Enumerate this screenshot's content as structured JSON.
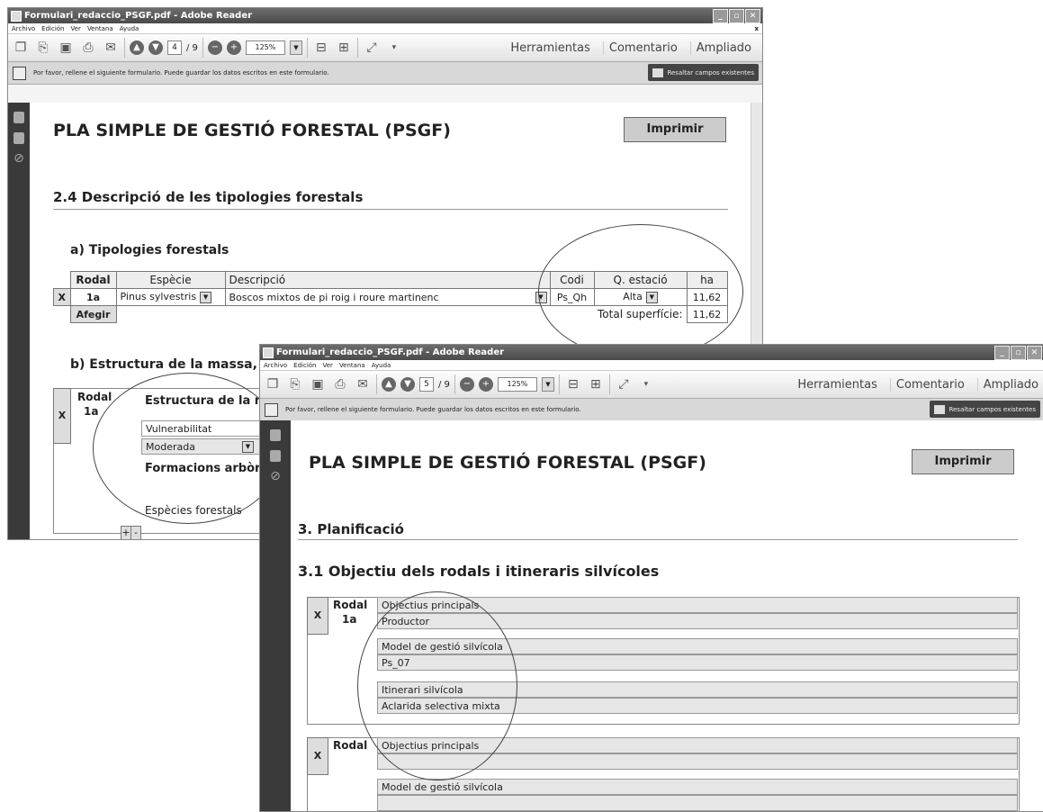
{
  "back": {
    "window_title": "Formulari_redaccio_PSGF.pdf - Adobe Reader",
    "menu": [
      "Archivo",
      "Edición",
      "Ver",
      "Ventana",
      "Ayuda"
    ],
    "page_current": "4",
    "page_total": "/ 9",
    "zoom": "125%",
    "tools_label": "Herramientas",
    "comment_label": "Comentario",
    "extended_label": "Ampliado",
    "info_message": "Por favor, rellene el siguiente formulario. Puede guardar los datos escritos en este formulario.",
    "highlight_label": "Resaltar campos existentes",
    "doc_title": "PLA SIMPLE DE GESTIÓ FORESTAL (PSGF)",
    "print_label": "Imprimir",
    "section_title": "2.4 Descripció de les tipologies forestals",
    "subsection_a": "a) Tipologies forestals",
    "table_a": {
      "headers": [
        "Rodal",
        "Espècie",
        "Descripció",
        "Codi",
        "Q. estació",
        "ha"
      ],
      "row": {
        "x": "X",
        "rodal": "1a",
        "especie": "Pinus sylvestris",
        "descripcio": "Boscos mixtos de pi roig i roure martinenc",
        "codi": "Ps_Qh",
        "q_estacio": "Alta",
        "ha": "11,62"
      },
      "add_label": "Afegir",
      "total_label": "Total superfície:",
      "total_value": "11,62"
    },
    "subsection_b": "b) Estructura de la massa, for",
    "table_b": {
      "x": "X",
      "rodal_header": "Rodal",
      "rodal_value": "1a",
      "estructura_label": "Estructura de la ma",
      "vulnerabilitat_label": "Vulnerabilitat",
      "vulnerabilitat_value": "Moderada",
      "formacions_label": "Formacions arbòrie",
      "especies_label": "Espècies forestals",
      "plus": "+",
      "minus": "-"
    }
  },
  "front": {
    "window_title": "Formulari_redaccio_PSGF.pdf - Adobe Reader",
    "menu": [
      "Archivo",
      "Edición",
      "Ver",
      "Ventana",
      "Ayuda"
    ],
    "page_current": "5",
    "page_total": "/ 9",
    "zoom": "125%",
    "tools_label": "Herramientas",
    "comment_label": "Comentario",
    "extended_label": "Ampliado",
    "info_message": "Por favor, rellene el siguiente formulario. Puede guardar los datos escritos en este formulario.",
    "highlight_label": "Resaltar campos existentes",
    "doc_title": "PLA SIMPLE DE GESTIÓ FORESTAL (PSGF)",
    "print_label": "Imprimir",
    "section_title": "3. Planificació",
    "subsection_title": "3.1 Objectiu dels rodals i itineraris silvícoles",
    "block1": {
      "x": "X",
      "rodal_header": "Rodal",
      "rodal_value": "1a",
      "objectius_label": "Objectius principals",
      "objectius_value": "Productor",
      "model_label": "Model de gestió silvícola",
      "model_value": "Ps_07",
      "itinerari_label": "Itinerari silvícola",
      "itinerari_value": "Aclarida selectiva mixta"
    },
    "block2": {
      "x": "X",
      "rodal_header": "Rodal",
      "objectius_label": "Objectius principals",
      "model_label": "Model de gestió silvícola"
    }
  }
}
